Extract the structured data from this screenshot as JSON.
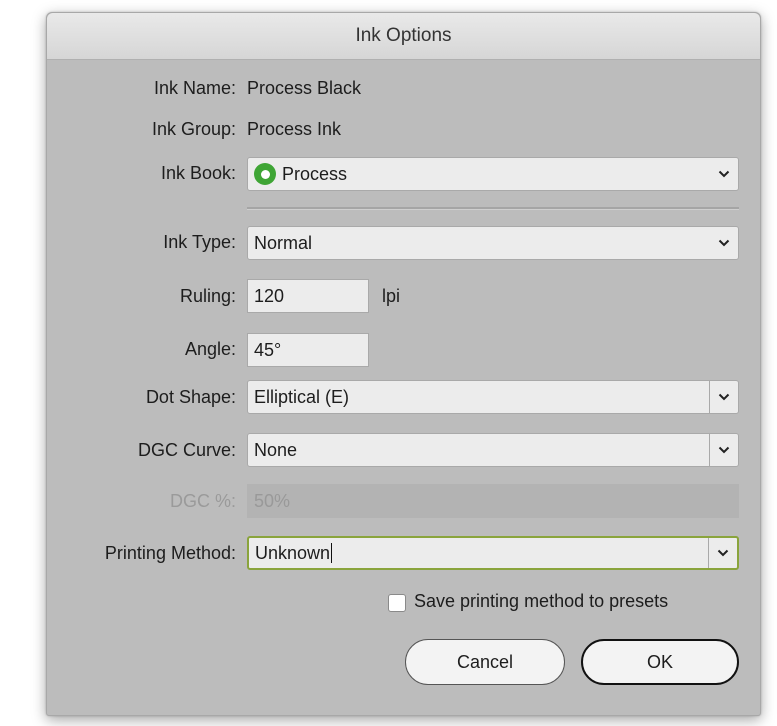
{
  "dialog": {
    "title": "Ink Options",
    "ink_name": {
      "label": "Ink Name:",
      "value": "Process Black"
    },
    "ink_group": {
      "label": "Ink Group:",
      "value": "Process Ink"
    },
    "ink_book": {
      "label": "Ink Book:",
      "value": "Process",
      "icon": "process-ink-icon",
      "icon_color": "#3fa535"
    },
    "ink_type": {
      "label": "Ink Type:",
      "value": "Normal"
    },
    "ruling": {
      "label": "Ruling:",
      "value": "120",
      "unit": "lpi"
    },
    "angle": {
      "label": "Angle:",
      "value": "45°"
    },
    "dot_shape": {
      "label": "Dot Shape:",
      "value": "Elliptical (E)"
    },
    "dgc_curve": {
      "label": "DGC Curve:",
      "value": "None"
    },
    "dgc_percent": {
      "label": "DGC %:",
      "value": "50%",
      "enabled": false
    },
    "printing_method": {
      "label": "Printing Method:",
      "value": "Unknown"
    },
    "save_presets": {
      "label": "Save printing method to presets",
      "checked": false
    },
    "buttons": {
      "cancel": "Cancel",
      "ok": "OK"
    }
  },
  "colors": {
    "focus_ring": "#8aa43c",
    "dialog_bg": "#bcbcbc"
  }
}
